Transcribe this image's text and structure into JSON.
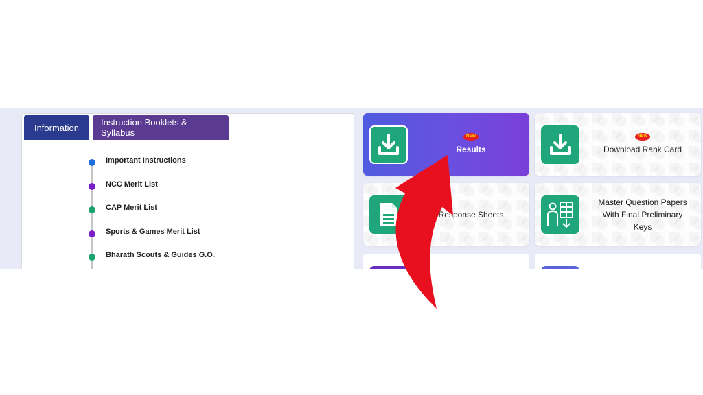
{
  "tabs": {
    "information": "Information",
    "booklets": "Instruction Booklets & Syllabus"
  },
  "timeline": [
    {
      "label": "Important Instructions",
      "color": "#1e6fd9"
    },
    {
      "label": "NCC Merit List",
      "color": "#7a1fc4"
    },
    {
      "label": "CAP Merit List",
      "color": "#19a46e"
    },
    {
      "label": "Sports & Games Merit List",
      "color": "#7a1fc4"
    },
    {
      "label": "Bharath Scouts & Guides G.O.",
      "color": "#19a46e"
    }
  ],
  "tiles": {
    "results": {
      "label": "Results",
      "badge": "NEW",
      "icon": "download-icon"
    },
    "rank_card": {
      "label": "Download Rank Card",
      "badge": "NEW",
      "icon": "download-icon"
    },
    "response_sheets": {
      "label": "Response Sheets",
      "icon": "document-icon"
    },
    "master_papers": {
      "line1": "Master Question Papers",
      "line2": "With Final Preliminary",
      "line3": "Keys",
      "icon": "question-paper-icon"
    }
  },
  "colors": {
    "accent_green": "#1fa67a",
    "tab_info": "#2a3a8f",
    "tab_booklets": "#5b3a92",
    "featured_gradient_start": "#4f5be0",
    "featured_gradient_end": "#7a3fd8",
    "arrow_red": "#e8101f"
  }
}
